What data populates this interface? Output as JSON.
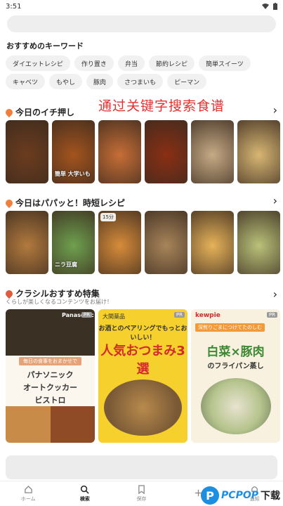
{
  "status": {
    "time": "3:51"
  },
  "keywords": {
    "title": "おすすめのキーワード",
    "row1": [
      "ダイエットレシピ",
      "作り置き",
      "弁当",
      "節約レシピ",
      "簡単スイーツ"
    ],
    "row2": [
      "キャベツ",
      "もやし",
      "豚肉",
      "さつまいも",
      "ピーマン"
    ]
  },
  "overlay_text": "通过关键字搜索食谱",
  "section1": {
    "title": "今日のイチ押し",
    "thumbs": [
      {
        "tag": "",
        "cap": "",
        "color": "#6b3c1e"
      },
      {
        "tag": "",
        "cap": "簡単 大学いも",
        "color": "#a4541e"
      },
      {
        "tag": "",
        "cap": "",
        "color": "#c76e36"
      },
      {
        "tag": "",
        "cap": "",
        "color": "#8a2f14"
      },
      {
        "tag": "",
        "cap": "",
        "color": "#c7ab86"
      },
      {
        "tag": "",
        "cap": "",
        "color": "#d8b774"
      }
    ]
  },
  "section2": {
    "title": "今日はパパッと！時短レシピ",
    "thumbs": [
      {
        "tag": "",
        "cap": "",
        "color": "#b27a3e"
      },
      {
        "tag": "",
        "cap": "ニラ豆腐",
        "color": "#6fa04f"
      },
      {
        "tag": "15分",
        "cap": "",
        "color": "#d78c3a"
      },
      {
        "tag": "",
        "cap": "",
        "color": "#a8855a"
      },
      {
        "tag": "",
        "cap": "",
        "color": "#e7b35a"
      },
      {
        "tag": "",
        "cap": "",
        "color": "#b9c27a"
      }
    ]
  },
  "section3": {
    "title": "クラシルおすすめ特集",
    "subtitle": "くらしが楽しくなるコンテンツをお届け！",
    "feature1": {
      "brand": "Panasonic",
      "pr": "PR",
      "note": "毎日の食事をおまかせで",
      "lines": [
        "パナソニック",
        "オートクッカー",
        "ビストロ"
      ]
    },
    "feature2": {
      "brand": "大関薬品",
      "pr": "PR",
      "head": "お酒とのペアリングでもっとおいしい！",
      "title": "人気おつまみ3選"
    },
    "feature3": {
      "brand": "kewpie",
      "pr": "PR",
      "strip": "深煎りごまにつけてたのしむ",
      "title": "白菜×豚肉",
      "sub": "のフライパン蒸し"
    }
  },
  "nav": {
    "items": [
      {
        "label": "ホーム",
        "icon": "home-icon",
        "active": false
      },
      {
        "label": "検索",
        "icon": "search-icon",
        "active": true
      },
      {
        "label": "保存",
        "icon": "bookmark-icon",
        "active": false
      },
      {
        "label": "",
        "icon": "add-icon",
        "active": false
      },
      {
        "label": "通知",
        "icon": "bell-icon",
        "active": false
      }
    ]
  },
  "watermark": {
    "logo": "P",
    "text1": "PCPOP",
    "text2": "下载"
  }
}
